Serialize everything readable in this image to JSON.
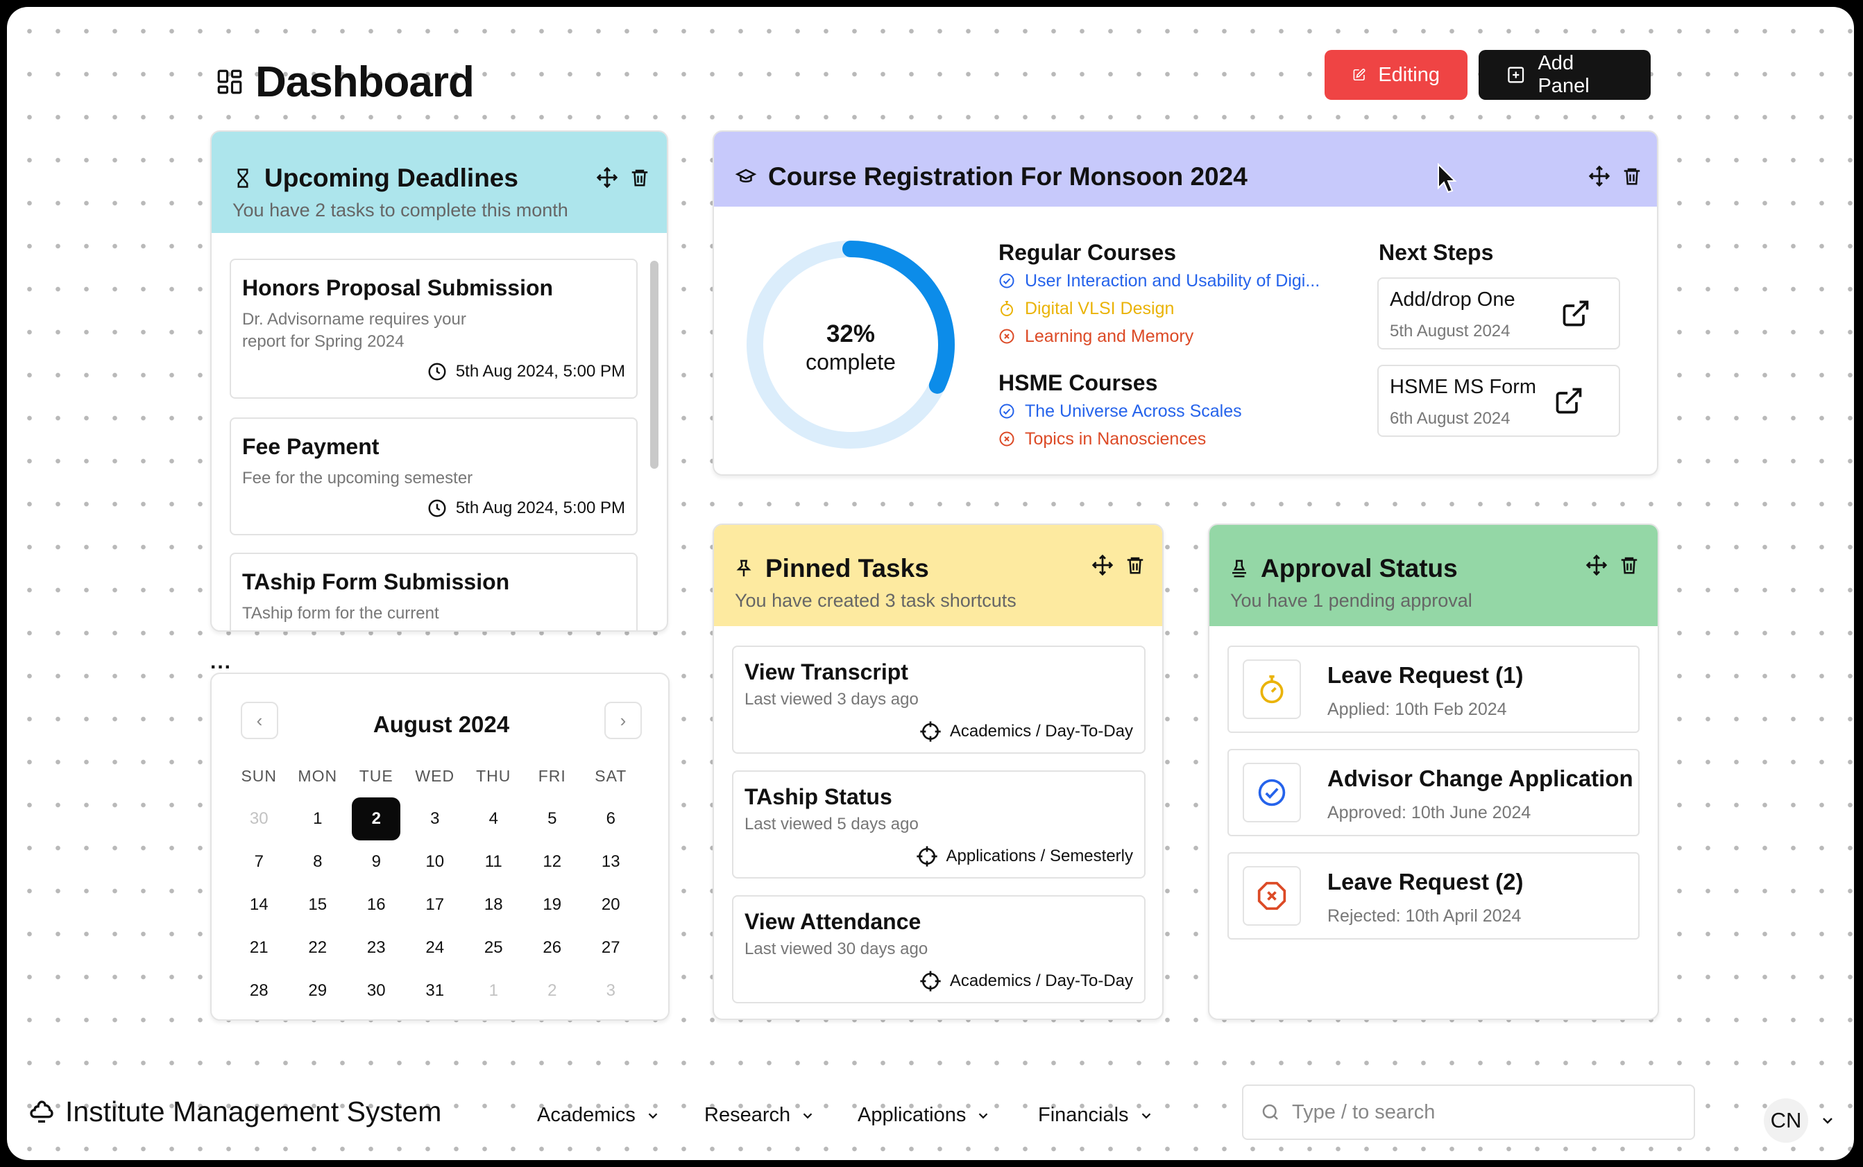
{
  "header": {
    "title": "Dashboard",
    "editing_label": "Editing",
    "add_panel_label": "Add Panel"
  },
  "deadlines": {
    "title": "Upcoming Deadlines",
    "subtitle": "You have 2 tasks to complete this month",
    "header_color": "#ade5ec",
    "items": [
      {
        "title": "Honors Proposal Submission",
        "desc1": "Dr. Advisorname requires your",
        "desc2": "report for Spring 2024",
        "due": "5th Aug 2024, 5:00 PM"
      },
      {
        "title": "Fee Payment",
        "desc1": "Fee for the upcoming semester",
        "desc2": "",
        "due": "5th Aug 2024, 5:00 PM"
      },
      {
        "title": "TAship Form Submission",
        "desc1": "TAship form for the current",
        "desc2": "",
        "due": ""
      }
    ]
  },
  "calendar": {
    "ellipsis": "...",
    "month": "August 2024",
    "prev_icon": "‹",
    "next_icon": "›",
    "weekdays": [
      "SUN",
      "MON",
      "TUE",
      "WED",
      "THU",
      "FRI",
      "SAT"
    ],
    "weeks": [
      [
        "30",
        "1",
        "2",
        "3",
        "4",
        "5",
        "6"
      ],
      [
        "7",
        "8",
        "9",
        "10",
        "11",
        "12",
        "13"
      ],
      [
        "14",
        "15",
        "16",
        "17",
        "18",
        "19",
        "20"
      ],
      [
        "21",
        "22",
        "23",
        "24",
        "25",
        "26",
        "27"
      ],
      [
        "28",
        "29",
        "30",
        "31",
        "1",
        "2",
        "3"
      ]
    ],
    "selected": "2"
  },
  "registration": {
    "title": "Course Registration For Monsoon 2024",
    "header_color": "#c7c9fb",
    "progress_percent": 32,
    "progress_label": "32%",
    "progress_caption": "complete",
    "regular_title": "Regular Courses",
    "regular": [
      {
        "name": "User Interaction and Usability of Digi...",
        "status": "approved"
      },
      {
        "name": "Digital VLSI Design",
        "status": "pending"
      },
      {
        "name": "Learning and Memory",
        "status": "rejected"
      }
    ],
    "hsme_title": "HSME Courses",
    "hsme": [
      {
        "name": "The Universe Across Scales",
        "status": "approved"
      },
      {
        "name": "Topics in Nanosciences",
        "status": "rejected"
      }
    ],
    "next_steps_title": "Next Steps",
    "next_steps": [
      {
        "title": "Add/drop One",
        "date": "5th August 2024"
      },
      {
        "title": "HSME MS Form",
        "date": "6th August 2024"
      }
    ]
  },
  "pinned": {
    "title": "Pinned Tasks",
    "subtitle": "You have created 3 task shortcuts",
    "header_color": "#fdeaa0",
    "items": [
      {
        "title": "View Transcript",
        "viewed": "Last viewed 3 days ago",
        "category": "Academics / Day-To-Day"
      },
      {
        "title": "TAship Status",
        "viewed": "Last viewed 5 days ago",
        "category": "Applications / Semesterly"
      },
      {
        "title": "View Attendance",
        "viewed": "Last viewed 30 days ago",
        "category": "Academics / Day-To-Day"
      }
    ]
  },
  "approvals": {
    "title": "Approval Status",
    "subtitle": "You have 1 pending approval",
    "header_color": "#94d7a6",
    "items": [
      {
        "title": "Leave Request (1)",
        "sub": "Applied: 10th Feb 2024",
        "status": "pending"
      },
      {
        "title": "Advisor Change Application",
        "sub": "Approved: 10th June 2024",
        "status": "approved"
      },
      {
        "title": "Leave Request (2)",
        "sub": "Rejected: 10th April 2024",
        "status": "rejected"
      }
    ]
  },
  "colors": {
    "approved": "#2563eb",
    "pending": "#eab308",
    "rejected": "#dc4a26",
    "progress": "#0c8ce9",
    "progress_track": "#dbedfb"
  },
  "bottom": {
    "app_name": "Institute Management System",
    "nav": [
      "Academics",
      "Research",
      "Applications",
      "Financials"
    ],
    "search_placeholder": "Type / to search",
    "avatar": "CN"
  }
}
